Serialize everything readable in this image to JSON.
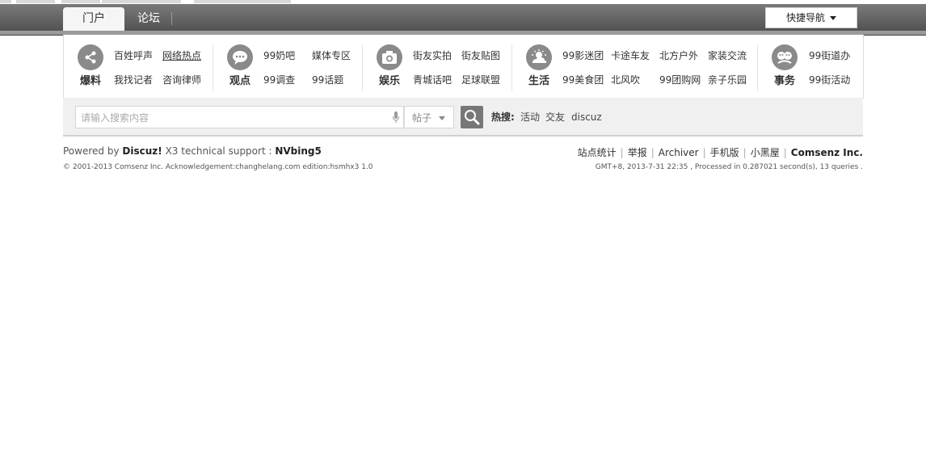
{
  "nav": {
    "tabs": [
      {
        "label": "门户"
      },
      {
        "label": "论坛"
      }
    ],
    "quick_nav_label": "快捷导航"
  },
  "channels": [
    {
      "name": "爆料",
      "icon": "share-icon",
      "links": [
        "百姓呼声",
        "网络热点",
        "我找记者",
        "咨询律师"
      ]
    },
    {
      "name": "观点",
      "icon": "speech-bubble-icon",
      "links": [
        "99奶吧",
        "媒体专区",
        "99调查",
        "99话题"
      ]
    },
    {
      "name": "娱乐",
      "icon": "camera-icon",
      "links": [
        "街友实拍",
        "街友贴图",
        "青城话吧",
        "足球联盟"
      ]
    },
    {
      "name": "生活",
      "icon": "cloud-sun-icon",
      "links": [
        "99影迷团",
        "卡途车友",
        "北方户外",
        "家装交流",
        "99美食团",
        "北风吹",
        "99团购网",
        "亲子乐园"
      ]
    },
    {
      "name": "事务",
      "icon": "people-icon",
      "links": [
        "99街道办",
        "99街活动"
      ]
    }
  ],
  "search": {
    "placeholder": "请输入搜索内容",
    "type_selected": "帖子",
    "hot_label": "热搜:",
    "hot_items": [
      "活动",
      "交友",
      "discuz"
    ]
  },
  "footer": {
    "powered_prefix": "Powered by",
    "product": "Discuz!",
    "version": "X3",
    "support_prefix": "technical support :",
    "support_name": "NVbing5",
    "copyright": "© 2001-2013",
    "company": "Comsenz Inc.",
    "ack": "Acknowledgement:changhelang.com edition:hsmhx3 1.0",
    "links": [
      "站点统计",
      "举报",
      "Archiver",
      "手机版",
      "小黑屋"
    ],
    "company_right": "Comsenz Inc.",
    "processed": "GMT+8, 2013-7-31 22:35 , Processed in 0.287021 second(s), 13 queries ."
  }
}
